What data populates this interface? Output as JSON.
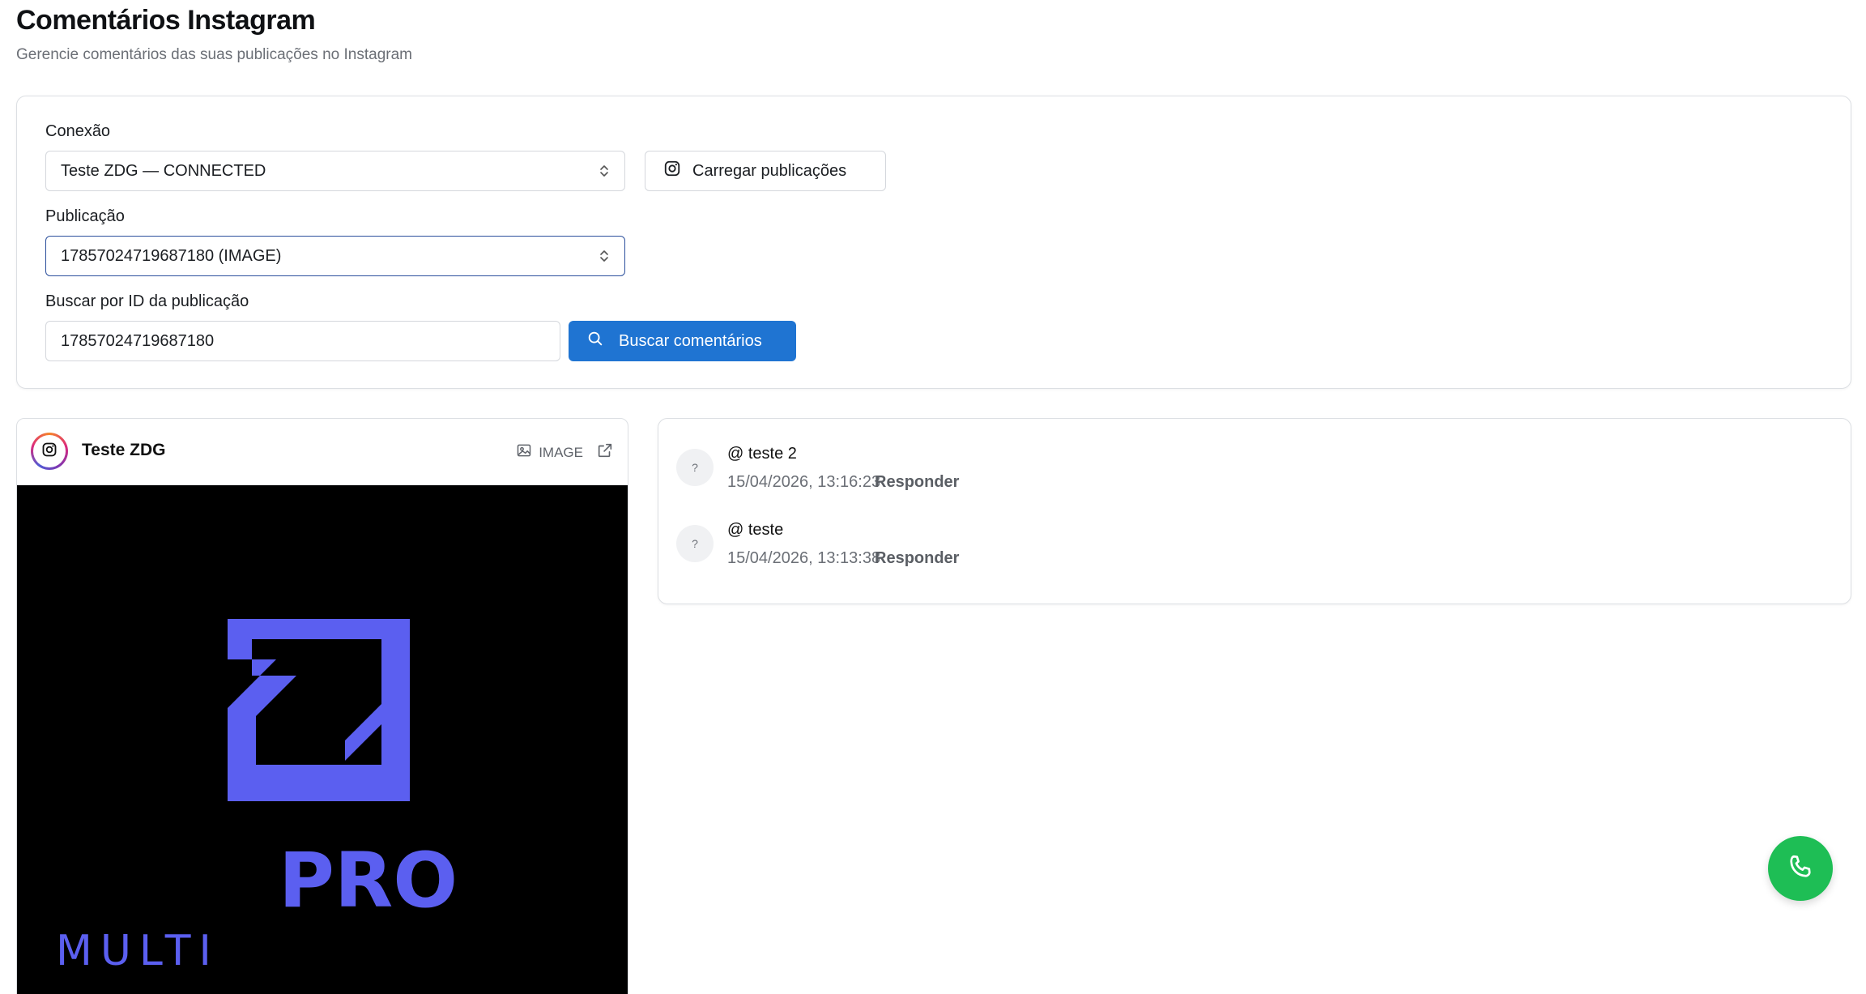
{
  "header": {
    "title": "Comentários Instagram",
    "subtitle": "Gerencie comentários das suas publicações no Instagram"
  },
  "filters": {
    "connection_label": "Conexão",
    "connection_value": "Teste ZDG — CONNECTED",
    "load_posts_label": "Carregar publicações",
    "post_label": "Publicação",
    "post_value": "17857024719687180 (IMAGE)",
    "search_label": "Buscar por ID da publicação",
    "search_value": "17857024719687180",
    "search_button_label": "Buscar comentários"
  },
  "post": {
    "account_name": "Teste ZDG",
    "media_type": "IMAGE",
    "image_text_pro": "PRO",
    "image_text_multi": "MULTI"
  },
  "comments": [
    {
      "author": "@ teste 2",
      "timestamp": "15/04/2026, 13:16:23",
      "avatar": "?",
      "reply_label": "Responder"
    },
    {
      "author": "@ teste",
      "timestamp": "15/04/2026, 13:13:38",
      "avatar": "?",
      "reply_label": "Responder"
    }
  ],
  "colors": {
    "primary": "#1f74d2",
    "fab": "#1ebe55",
    "logo": "#5b5ff0"
  },
  "icons": {
    "fab": "phone-icon",
    "search_button": "search-icon",
    "load_button": "instagram-icon"
  }
}
